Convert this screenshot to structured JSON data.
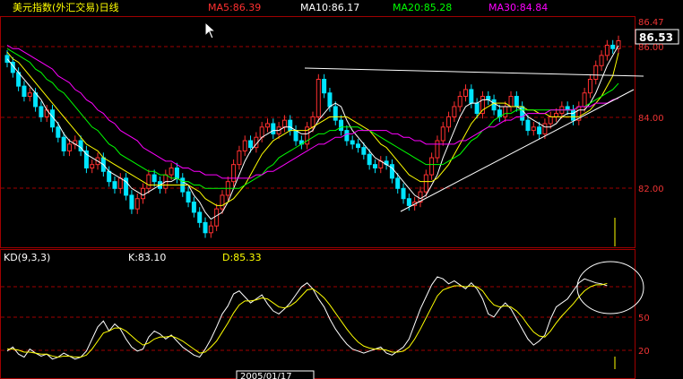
{
  "header": {
    "title": "美元指数(外汇交易)日线",
    "ma5": "MA5:86.39",
    "ma10": "MA10:86.17",
    "ma20": "MA20:85.28",
    "ma30": "MA30:84.84"
  },
  "price_axis": {
    "ticks": [
      "86.00",
      "84.00",
      "82.00"
    ],
    "high_label": "86.47",
    "current_label": "86.53"
  },
  "kd": {
    "title": "KD(9,3,3)",
    "k": "K:83.10",
    "d": "D:85.33",
    "ticks": [
      "50",
      "20"
    ]
  },
  "date_box": "2005/01/17",
  "colors": {
    "background": "#000000",
    "bull": "#ff3030",
    "bear": "#00e5ff",
    "ma5": "#ffffff",
    "ma10": "#ffff00",
    "ma20": "#00ff00",
    "ma30": "#ff00ff",
    "grid": "#a00000",
    "header_title": "#ffff00",
    "ma5_label": "#ff3030",
    "ma10_label": "#ffffff",
    "ma20_label": "#00ff00",
    "ma30_label": "#ff00ff",
    "kd_title": "#ffffff",
    "k_label": "#ffffff",
    "d_label": "#ffff00"
  },
  "chart_data": {
    "type": "line",
    "price_ylim": [
      80.5,
      87.2
    ],
    "kd_ylim": [
      0,
      100
    ],
    "close": [
      85.9,
      85.6,
      85.2,
      84.9,
      85.0,
      84.6,
      84.3,
      84.5,
      84.0,
      83.7,
      83.3,
      83.5,
      83.6,
      83.3,
      82.8,
      82.9,
      83.1,
      82.7,
      82.4,
      82.2,
      82.5,
      82.0,
      81.6,
      81.9,
      82.2,
      82.6,
      82.4,
      82.2,
      82.6,
      82.8,
      82.5,
      82.1,
      81.8,
      81.5,
      81.2,
      80.9,
      81.1,
      81.6,
      82.0,
      82.4,
      82.9,
      83.3,
      83.6,
      83.4,
      83.7,
      84.0,
      84.1,
      83.8,
      84.0,
      84.2,
      83.9,
      83.6,
      83.5,
      84.0,
      84.3,
      85.4,
      85.0,
      84.6,
      84.2,
      83.9,
      83.6,
      83.5,
      83.4,
      83.2,
      82.9,
      82.8,
      83.0,
      82.9,
      82.5,
      82.2,
      81.9,
      81.7,
      81.8,
      82.1,
      82.6,
      83.1,
      83.6,
      84.0,
      84.3,
      84.6,
      84.9,
      85.1,
      84.7,
      84.4,
      84.9,
      84.8,
      84.5,
      84.3,
      84.6,
      84.9,
      84.6,
      84.2,
      83.9,
      84.0,
      83.8,
      84.1,
      84.3,
      84.4,
      84.6,
      84.5,
      84.2,
      84.6,
      85.0,
      85.4,
      85.8,
      86.1,
      86.4,
      86.3,
      86.53
    ],
    "series": [
      {
        "name": "MA5",
        "values": [
          86.0,
          85.8,
          85.6,
          85.4,
          85.2,
          85.0,
          84.8,
          84.5,
          84.3,
          84.1,
          83.8,
          83.6,
          83.5,
          83.4,
          83.2,
          83.1,
          83.0,
          82.9,
          82.7,
          82.6,
          82.5,
          82.4,
          82.2,
          82.1,
          82.0,
          82.1,
          82.2,
          82.3,
          82.4,
          82.4,
          82.5,
          82.4,
          82.3,
          82.0,
          81.8,
          81.5,
          81.3,
          81.4,
          81.5,
          81.8,
          82.2,
          82.6,
          83.0,
          83.3,
          83.5,
          83.7,
          83.8,
          83.9,
          83.9,
          84.0,
          84.0,
          83.9,
          83.8,
          83.8,
          83.9,
          84.2,
          84.4,
          84.6,
          84.7,
          84.6,
          84.2,
          83.9,
          83.7,
          83.5,
          83.3,
          83.1,
          83.0,
          82.9,
          82.8,
          82.6,
          82.4,
          82.2,
          82.0,
          81.9,
          82.0,
          82.3,
          82.6,
          83.1,
          83.5,
          83.9,
          84.3,
          84.6,
          84.7,
          84.7,
          84.8,
          84.8,
          84.7,
          84.6,
          84.6,
          84.6,
          84.6,
          84.5,
          84.3,
          84.2,
          84.1,
          84.0,
          84.0,
          84.1,
          84.3,
          84.4,
          84.4,
          84.5,
          84.5,
          84.7,
          85.0,
          85.4,
          85.8,
          86.1,
          86.39
        ]
      },
      {
        "name": "MA10",
        "values": [
          86.2,
          86.0,
          85.9,
          85.7,
          85.5,
          85.3,
          85.1,
          84.9,
          84.7,
          84.5,
          84.3,
          84.1,
          83.9,
          83.7,
          83.5,
          83.4,
          83.3,
          83.1,
          83.0,
          82.9,
          82.8,
          82.7,
          82.6,
          82.5,
          82.4,
          82.3,
          82.3,
          82.3,
          82.3,
          82.3,
          82.3,
          82.3,
          82.3,
          82.2,
          82.1,
          81.9,
          81.8,
          81.7,
          81.7,
          81.8,
          81.9,
          82.1,
          82.3,
          82.6,
          82.9,
          83.2,
          83.4,
          83.6,
          83.7,
          83.8,
          83.9,
          83.9,
          83.9,
          83.9,
          84.0,
          84.1,
          84.2,
          84.3,
          84.3,
          84.3,
          84.3,
          84.2,
          84.1,
          84.0,
          83.9,
          83.7,
          83.5,
          83.4,
          83.2,
          83.0,
          82.8,
          82.6,
          82.5,
          82.4,
          82.4,
          82.4,
          82.5,
          82.7,
          82.9,
          83.2,
          83.5,
          83.8,
          84.1,
          84.3,
          84.5,
          84.6,
          84.7,
          84.7,
          84.7,
          84.6,
          84.6,
          84.6,
          84.5,
          84.5,
          84.4,
          84.4,
          84.3,
          84.3,
          84.3,
          84.3,
          84.3,
          84.3,
          84.4,
          84.5,
          84.7,
          84.9,
          85.2,
          85.5,
          86.17
        ]
      },
      {
        "name": "MA20",
        "values": [
          86.3,
          86.2,
          86.1,
          86.0,
          85.9,
          85.7,
          85.6,
          85.4,
          85.3,
          85.1,
          85.0,
          84.8,
          84.6,
          84.4,
          84.2,
          84.0,
          83.9,
          83.7,
          83.5,
          83.4,
          83.2,
          83.1,
          83.0,
          82.9,
          82.8,
          82.7,
          82.7,
          82.6,
          82.6,
          82.5,
          82.5,
          82.4,
          82.4,
          82.3,
          82.3,
          82.2,
          82.2,
          82.2,
          82.2,
          82.2,
          82.2,
          82.2,
          82.3,
          82.4,
          82.5,
          82.6,
          82.8,
          82.9,
          83.1,
          83.2,
          83.3,
          83.4,
          83.5,
          83.6,
          83.7,
          83.8,
          83.8,
          83.9,
          83.9,
          84.0,
          84.0,
          84.0,
          84.0,
          83.9,
          83.9,
          83.8,
          83.7,
          83.6,
          83.5,
          83.4,
          83.3,
          83.2,
          83.1,
          83.0,
          82.9,
          82.9,
          82.9,
          82.9,
          83.0,
          83.1,
          83.2,
          83.4,
          83.6,
          83.7,
          83.9,
          84.0,
          84.2,
          84.3,
          84.4,
          84.4,
          84.5,
          84.5,
          84.5,
          84.5,
          84.5,
          84.5,
          84.5,
          84.5,
          84.5,
          84.5,
          84.5,
          84.6,
          84.6,
          84.7,
          84.8,
          84.9,
          85.0,
          85.1,
          85.28
        ]
      },
      {
        "name": "MA30",
        "values": [
          86.4,
          86.3,
          86.3,
          86.2,
          86.1,
          86.0,
          85.9,
          85.8,
          85.7,
          85.5,
          85.4,
          85.3,
          85.1,
          85.0,
          84.8,
          84.7,
          84.5,
          84.4,
          84.2,
          84.1,
          83.9,
          83.8,
          83.7,
          83.6,
          83.4,
          83.3,
          83.2,
          83.1,
          83.0,
          83.0,
          82.9,
          82.8,
          82.8,
          82.7,
          82.7,
          82.6,
          82.6,
          82.6,
          82.5,
          82.5,
          82.5,
          82.5,
          82.5,
          82.5,
          82.6,
          82.6,
          82.7,
          82.7,
          82.8,
          82.9,
          83.0,
          83.1,
          83.2,
          83.3,
          83.4,
          83.5,
          83.5,
          83.6,
          83.7,
          83.7,
          83.8,
          83.8,
          83.9,
          83.9,
          83.9,
          83.9,
          83.9,
          83.9,
          83.8,
          83.8,
          83.7,
          83.7,
          83.6,
          83.6,
          83.5,
          83.5,
          83.5,
          83.5,
          83.5,
          83.5,
          83.6,
          83.6,
          83.7,
          83.8,
          83.9,
          84.0,
          84.0,
          84.1,
          84.2,
          84.2,
          84.3,
          84.3,
          84.4,
          84.4,
          84.4,
          84.4,
          84.5,
          84.5,
          84.5,
          84.5,
          84.5,
          84.6,
          84.6,
          84.6,
          84.7,
          84.7,
          84.7,
          84.8,
          84.84
        ]
      }
    ],
    "kd_series": [
      {
        "name": "K",
        "values": [
          18,
          22,
          15,
          12,
          20,
          16,
          13,
          15,
          10,
          12,
          16,
          13,
          10,
          12,
          18,
          30,
          42,
          48,
          38,
          45,
          40,
          30,
          22,
          18,
          20,
          32,
          38,
          35,
          30,
          34,
          28,
          22,
          18,
          14,
          12,
          20,
          30,
          42,
          55,
          63,
          75,
          78,
          72,
          66,
          70,
          74,
          65,
          58,
          55,
          60,
          66,
          74,
          82,
          86,
          80,
          70,
          62,
          50,
          40,
          32,
          25,
          20,
          18,
          16,
          18,
          20,
          22,
          16,
          14,
          18,
          22,
          30,
          45,
          60,
          72,
          84,
          92,
          90,
          85,
          88,
          84,
          80,
          86,
          80,
          70,
          55,
          52,
          60,
          66,
          60,
          50,
          40,
          30,
          24,
          28,
          34,
          50,
          62,
          66,
          70,
          78,
          86,
          90,
          88,
          86,
          85,
          83.1
        ]
      },
      {
        "name": "D",
        "values": [
          20,
          20,
          19,
          17,
          17,
          16,
          15,
          15,
          13,
          12,
          13,
          13,
          12,
          12,
          14,
          20,
          28,
          36,
          38,
          41,
          41,
          38,
          33,
          28,
          24,
          26,
          30,
          32,
          32,
          33,
          31,
          28,
          24,
          20,
          16,
          17,
          22,
          28,
          37,
          46,
          56,
          64,
          68,
          68,
          69,
          71,
          70,
          66,
          62,
          61,
          63,
          67,
          73,
          79,
          80,
          76,
          71,
          64,
          56,
          48,
          40,
          33,
          27,
          23,
          21,
          20,
          20,
          19,
          17,
          17,
          18,
          22,
          30,
          40,
          51,
          62,
          73,
          79,
          81,
          83,
          83,
          82,
          83,
          82,
          78,
          70,
          64,
          62,
          63,
          62,
          58,
          52,
          44,
          37,
          33,
          32,
          38,
          46,
          53,
          59,
          65,
          72,
          78,
          82,
          84,
          84,
          85.33
        ]
      }
    ]
  }
}
